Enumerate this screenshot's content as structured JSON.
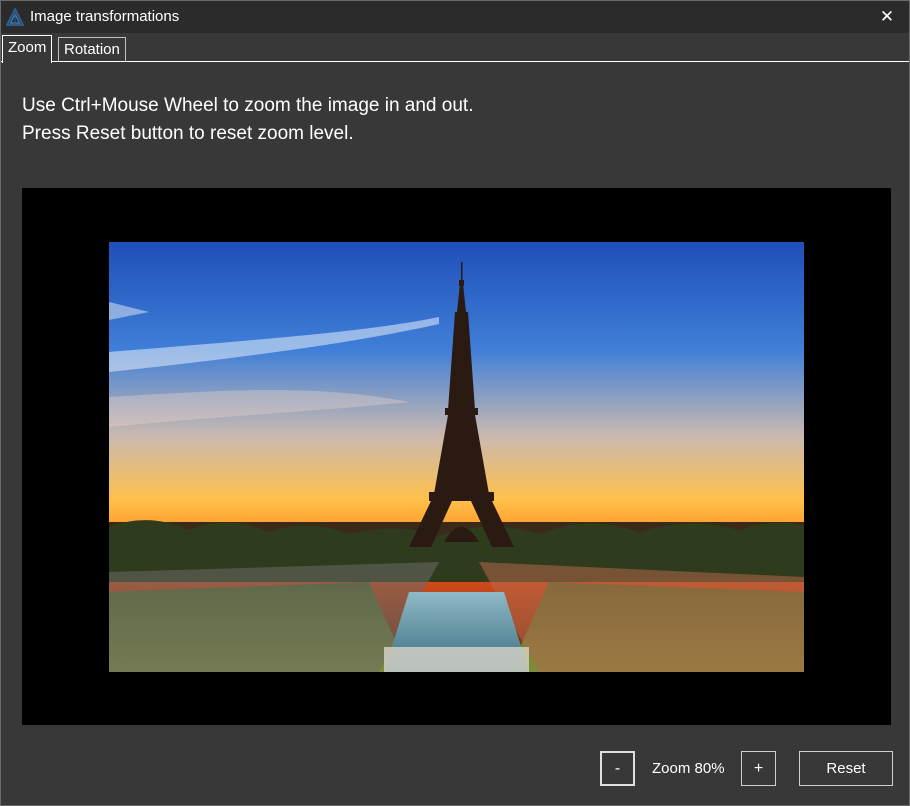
{
  "window": {
    "title": "Image transformations",
    "app_icon": "delta-triangle-icon",
    "close_icon": "close-icon",
    "close_glyph": "✕"
  },
  "tabs": [
    {
      "label": "Zoom",
      "active": true
    },
    {
      "label": "Rotation",
      "active": false
    }
  ],
  "zoom_tab": {
    "instruction_line1": "Use Ctrl+Mouse Wheel to zoom the image in and out.",
    "instruction_line2": "Press Reset button to reset zoom level.",
    "image_subject": "Eiffel Tower at sunset"
  },
  "controls": {
    "minus_label": "-",
    "zoom_text": "Zoom 80%",
    "zoom_level_percent": 80,
    "plus_label": "+",
    "reset_label": "Reset"
  },
  "colors": {
    "window_bg": "#383838",
    "titlebar_bg": "#2b2b2b",
    "viewer_bg": "#000000",
    "text": "#ffffff",
    "icon_accent": "#2f5d8a"
  }
}
